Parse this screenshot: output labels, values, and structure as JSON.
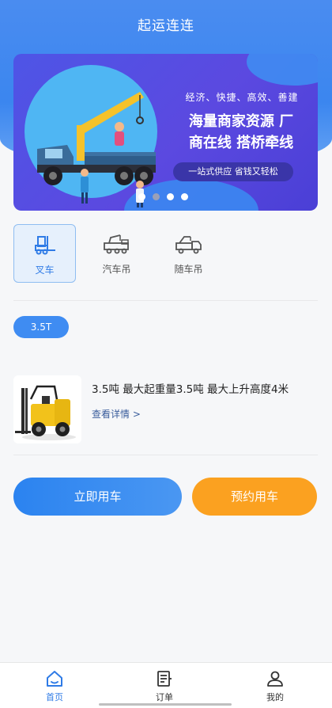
{
  "header": {
    "title": "起运连连"
  },
  "banner": {
    "tagline": "经济、快捷、高效、善建",
    "headline_line1": "海量商家资源 厂",
    "headline_line2": "商在线 搭桥牵线",
    "pill": "一站式供应 省钱又轻松",
    "dots_total": 4,
    "active_dot": 1
  },
  "categories": [
    {
      "label": "叉车",
      "icon": "forklift-icon",
      "active": true
    },
    {
      "label": "汽车吊",
      "icon": "truck-crane-icon",
      "active": false
    },
    {
      "label": "随车吊",
      "icon": "truck-mounted-crane-icon",
      "active": false
    }
  ],
  "tonnage": {
    "selected": "3.5T"
  },
  "product": {
    "description": "3.5吨 最大起重量3.5吨 最大上升高度4米",
    "more_link": "查看详情 >"
  },
  "actions": {
    "primary": "立即用车",
    "secondary": "预约用车"
  },
  "tabbar": {
    "items": [
      {
        "label": "首页",
        "icon": "home-icon",
        "active": true
      },
      {
        "label": "订单",
        "icon": "order-icon",
        "active": false
      },
      {
        "label": "我的",
        "icon": "profile-icon",
        "active": false
      }
    ]
  },
  "colors": {
    "primary": "#3f8cf2",
    "accent": "#fba120",
    "active_tab": "#2f7be6"
  }
}
